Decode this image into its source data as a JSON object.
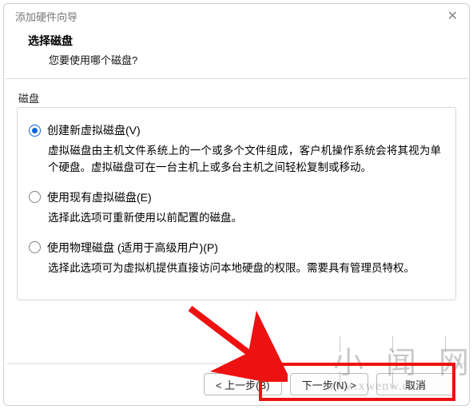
{
  "window": {
    "title": "添加硬件向导"
  },
  "header": {
    "title": "选择磁盘",
    "subtitle": "您要使用哪个磁盘?"
  },
  "group": {
    "label": "磁盘",
    "options": [
      {
        "label": "创建新虚拟磁盘(V)",
        "desc": "虚拟磁盘由主机文件系统上的一个或多个文件组成，客户机操作系统会将其视为单个硬盘。虚拟磁盘可在一台主机上或多台主机之间轻松复制或移动。",
        "checked": true
      },
      {
        "label": "使用现有虚拟磁盘(E)",
        "desc": "选择此选项可重新使用以前配置的磁盘。",
        "checked": false
      },
      {
        "label": "使用物理磁盘 (适用于高级用户)(P)",
        "desc": "选择此选项可为虚拟机提供直接访问本地硬盘的权限。需要具有管理员特权。",
        "checked": false
      }
    ]
  },
  "footer": {
    "back": "< 上一步(B)",
    "next": "下一步(N) >",
    "cancel": "取消"
  },
  "watermark": {
    "big": "小闻网",
    "url": "www.xwenw.com"
  }
}
